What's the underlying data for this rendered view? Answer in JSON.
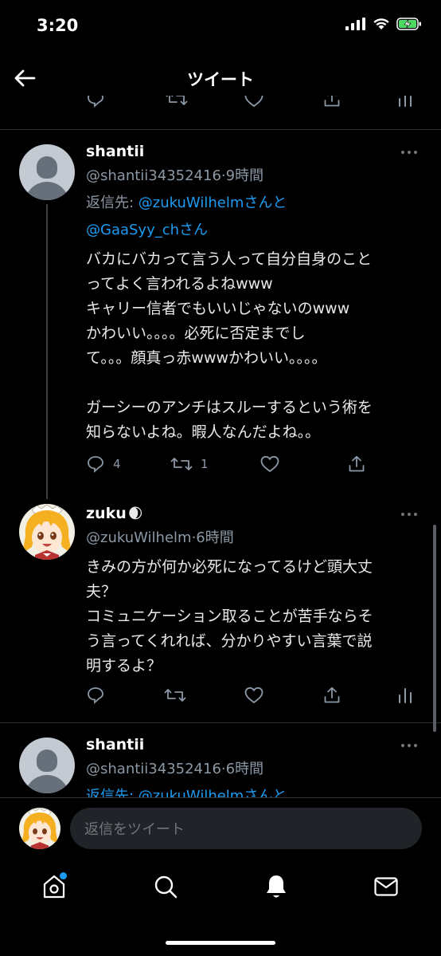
{
  "status_bar": {
    "time": "3:20"
  },
  "header": {
    "title": "ツイート"
  },
  "tweets": [
    {
      "name": "shantii",
      "handle": "@shantii34352416",
      "time": "9時間",
      "reply_prefix": "返信先: ",
      "reply_mention_1": "@zukuWilhelm",
      "reply_and": "さんと",
      "reply_mention_2": "@GaaSyy_ch",
      "reply_suffix": "さん",
      "text": "バカにバカって言う人って自分自身のこと\nってよく言われるよねwww\nキャリー信者でもいいじゃないのwww\nかわいい。。。。必死に否定までし\nて。。。顔真っ赤wwwかわいい。。。。\n\nガーシーのアンチはスルーするという術を\n知らないよね。暇人なんだよね。。",
      "reply_count": "4",
      "retweet_count": "1"
    },
    {
      "name": "zuku",
      "name_emoji": "🌒",
      "handle": "@zukuWilhelm",
      "time": "6時間",
      "text": "きみの方が何か必死になってるけど頭大丈\n夫？\nコミュニケーション取ることが苦手ならそ\nう言ってくれれば、分かりやすい言葉で説\n明するよ？"
    },
    {
      "name": "shantii",
      "handle": "@shantii34352416",
      "time": "6時間",
      "reply_partial": "返信先: @zukuWilhelmさんと"
    }
  ],
  "reply_bar": {
    "placeholder": "返信をツイート"
  },
  "tabs": [
    "home-icon",
    "search-icon",
    "notifications-bell-icon",
    "messages-mail-icon"
  ],
  "colors": {
    "accent": "#1d9bf0",
    "background": "#000000",
    "secondary_text": "#8b98a5"
  }
}
